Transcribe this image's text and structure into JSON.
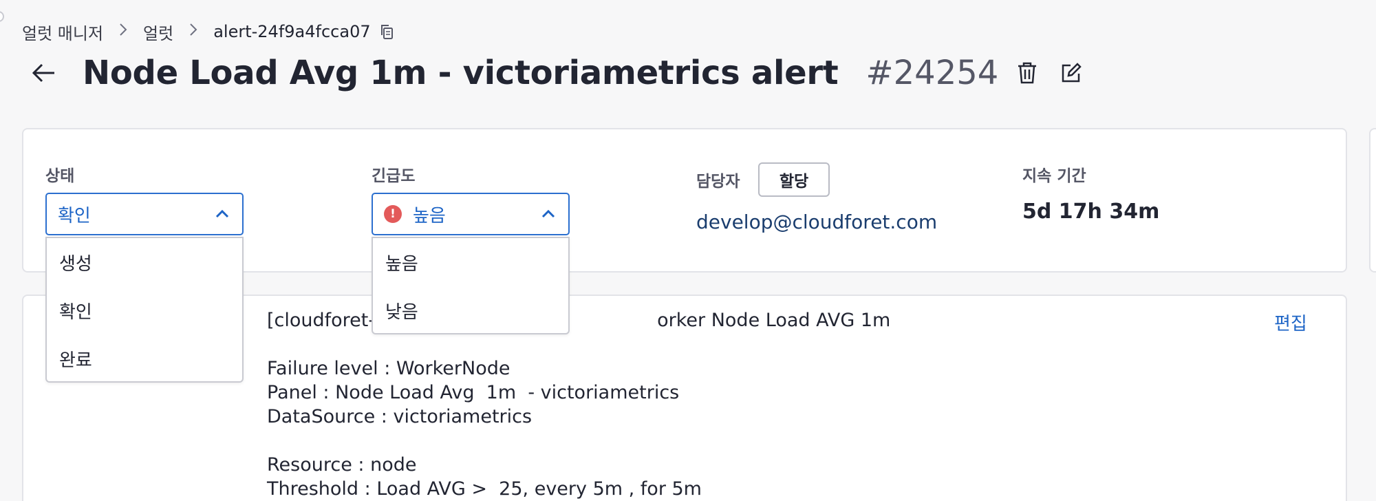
{
  "breadcrumb": {
    "items": [
      "얼럿 매니저",
      "얼럿"
    ],
    "current": "alert-24f9a4fcca07"
  },
  "header": {
    "title": "Node Load Avg 1m - victoriametrics alert",
    "number": "#24254"
  },
  "summary": {
    "state": {
      "label": "상태",
      "value": "확인"
    },
    "urgency": {
      "label": "긴급도",
      "value": "높음"
    },
    "assignee": {
      "label": "담당자",
      "assign_button": "할당",
      "email": "develop@cloudforet.com"
    },
    "duration": {
      "label": "지속 기간",
      "value": "5d 17h 34m"
    }
  },
  "state_dropdown": {
    "options": [
      "생성",
      "확인",
      "완료"
    ]
  },
  "urgency_dropdown": {
    "options": [
      "높음",
      "낮음"
    ]
  },
  "description": {
    "title_start": "[cloudforet-",
    "title_end": "orker Node Load AVG 1m",
    "lines": [
      "Failure level : WorkerNode",
      "Panel : Node Load Avg  1m  - victoriametrics",
      "DataSource : victoriametrics",
      "",
      "Resource : node",
      "Threshold : Load AVG >  25, every 5m , for 5m"
    ],
    "edit_label": "편집"
  },
  "colors": {
    "accent": "#1d64c6",
    "severity_high": "#e35a5a",
    "background": "#f7f7f8"
  }
}
